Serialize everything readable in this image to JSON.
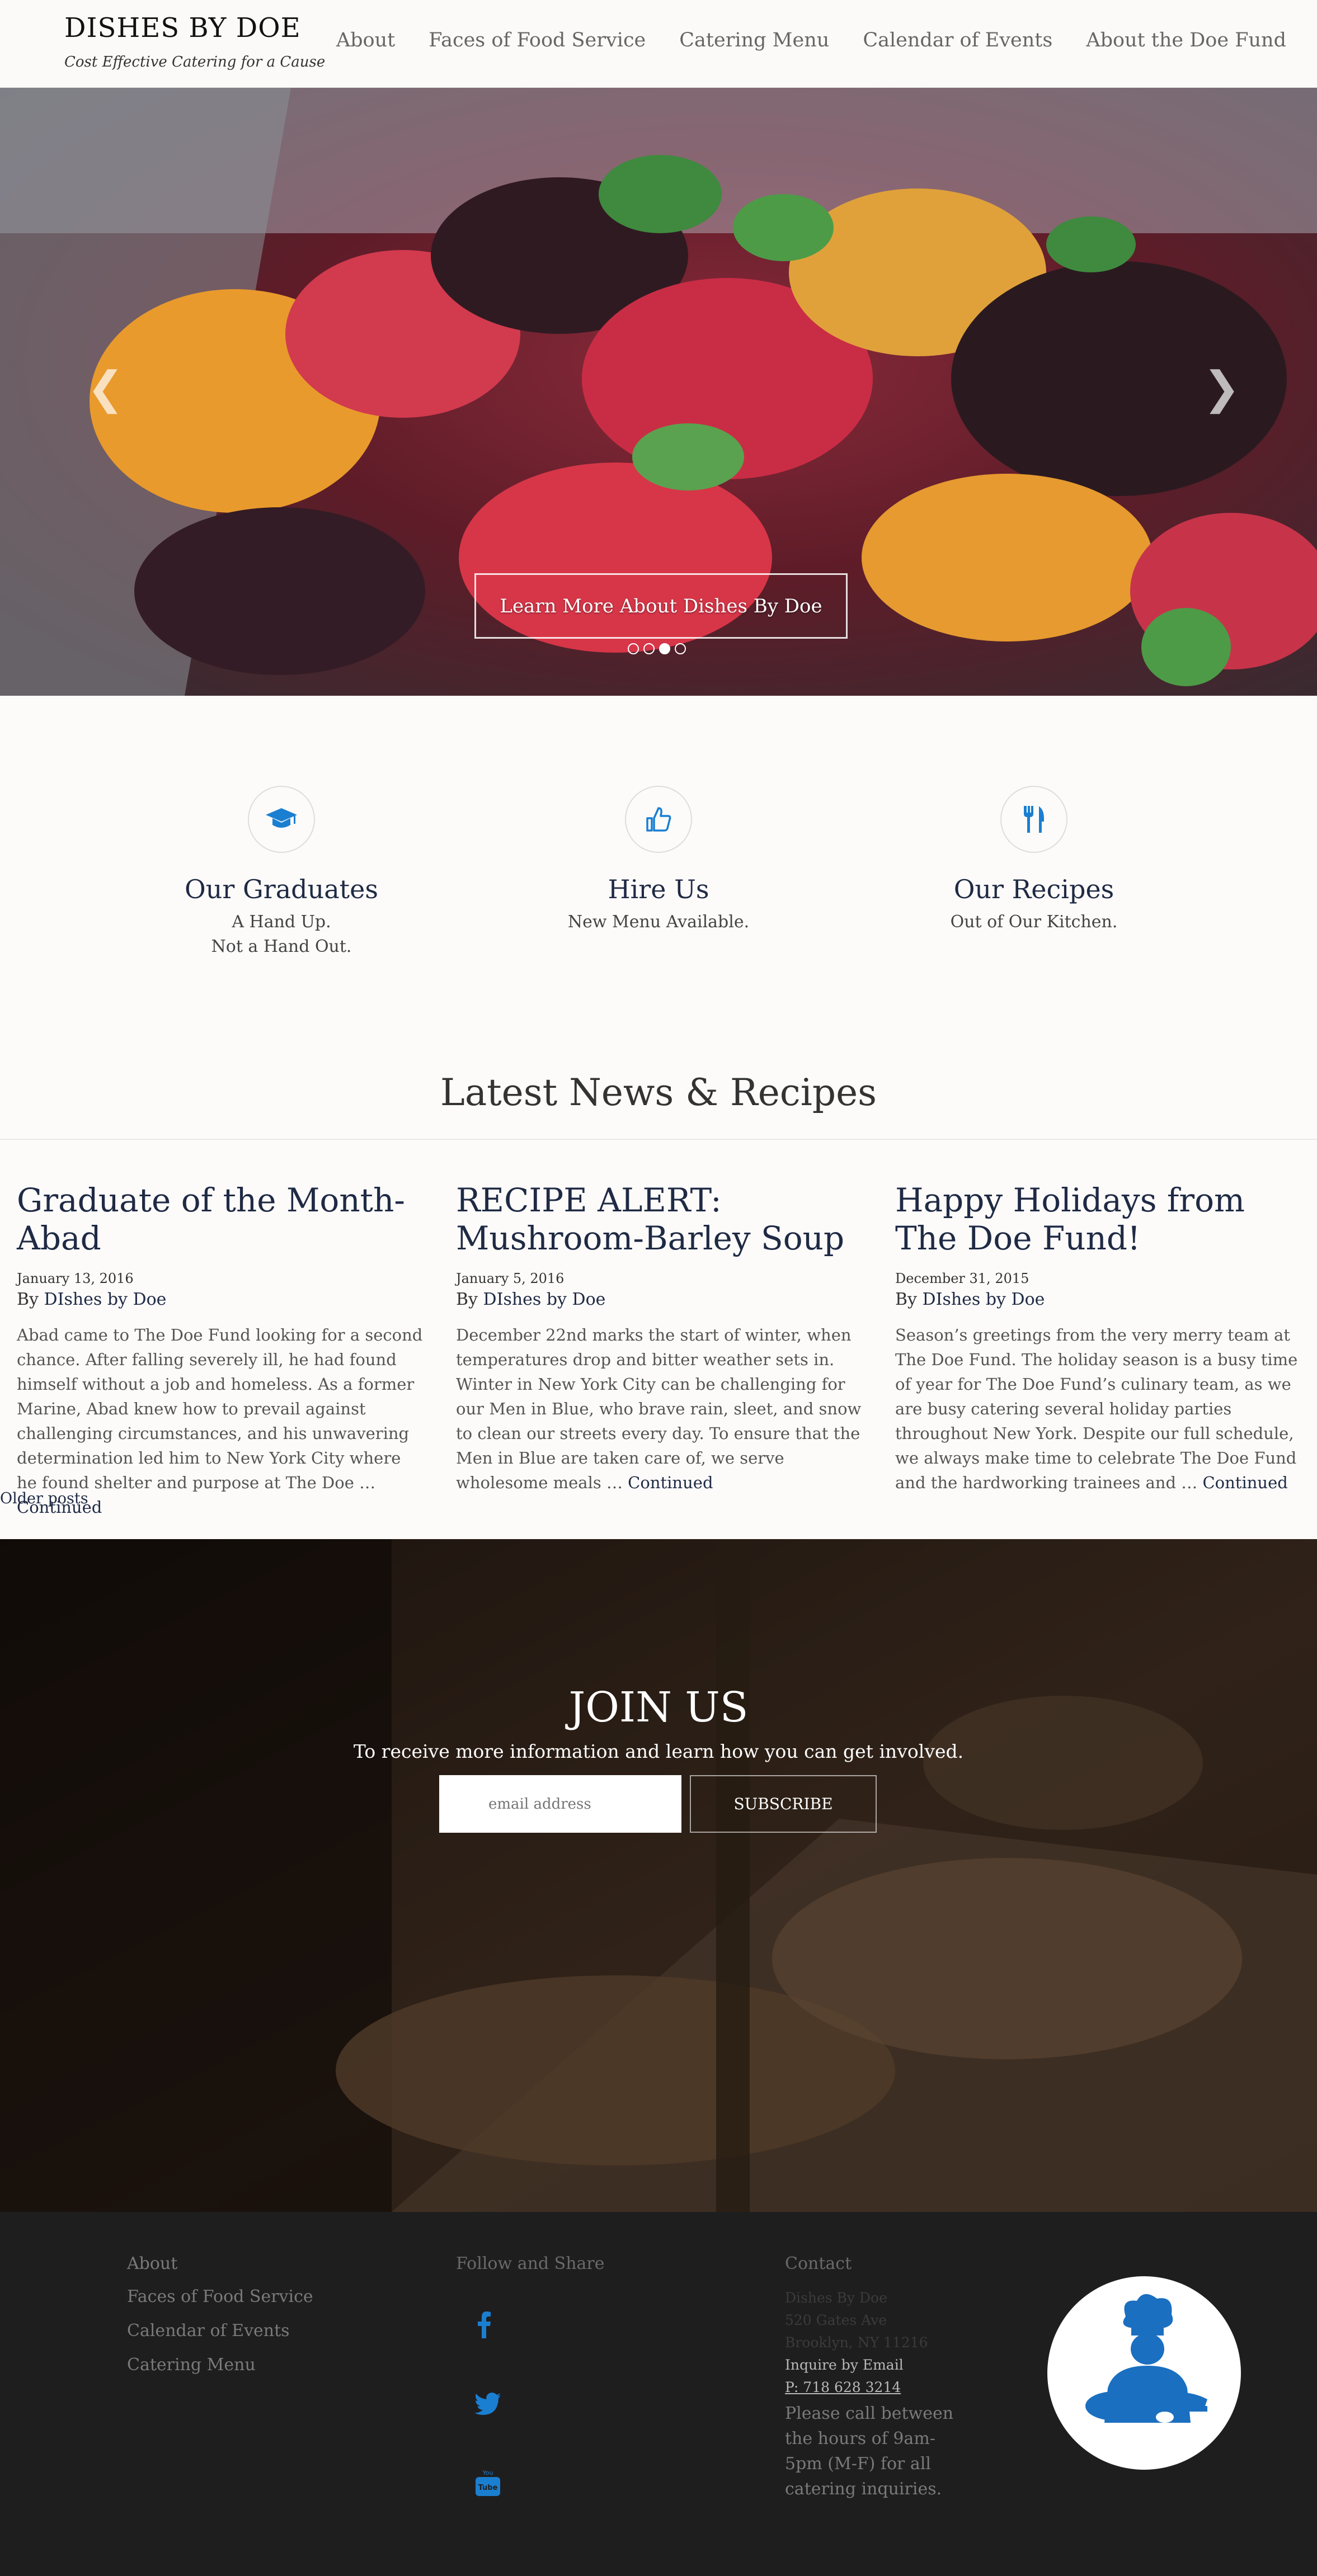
{
  "header": {
    "brand": "DISHES BY DOE",
    "tagline": "Cost Effective Catering for a Cause",
    "nav": [
      "About",
      "Faces of Food Service",
      "Catering Menu",
      "Calendar of Events",
      "About the Doe Fund"
    ]
  },
  "hero": {
    "cta": "Learn More About Dishes By Doe",
    "slides_count": 4,
    "active_slide": 3
  },
  "features": [
    {
      "icon": "graduation-cap-icon",
      "title": "Our Graduates",
      "lines": [
        "A Hand Up.",
        "Not a Hand Out."
      ]
    },
    {
      "icon": "thumbs-up-icon",
      "title": "Hire Us",
      "lines": [
        "New Menu Available."
      ]
    },
    {
      "icon": "fork-knife-icon",
      "title": "Our Recipes",
      "lines": [
        "Out of Our Kitchen."
      ]
    }
  ],
  "news": {
    "heading": "Latest News & Recipes",
    "posts": [
      {
        "title": "Graduate of the Month- Abad",
        "date": "January 13, 2016",
        "author_prefix": "By",
        "author": "DIshes by Doe",
        "excerpt": "Abad came to The Doe Fund looking for a second chance. After falling severely ill, he had found himself without a job and homeless. As a former Marine, Abad knew how to prevail against challenging circumstances, and his unwavering determination led him to New York City where he found shelter and purpose at The Doe …",
        "more": "Continued"
      },
      {
        "title": "RECIPE ALERT: Mushroom-Barley Soup",
        "date": "January 5, 2016",
        "author_prefix": "By",
        "author": "DIshes by Doe",
        "excerpt": "December 22nd marks the start of winter, when temperatures drop and bitter weather sets in. Winter in New York City can be challenging for our Men in Blue, who brave rain, sleet, and snow to clean our streets every day. To ensure that the Men in Blue are taken care of, we serve wholesome meals …",
        "more": "Continued"
      },
      {
        "title": "Happy Holidays from The Doe Fund!",
        "date": "December 31, 2015",
        "author_prefix": "By",
        "author": "DIshes by Doe",
        "excerpt": "Season’s greetings from the very merry team at The Doe Fund. The holiday season is a busy time of year for The Doe Fund’s culinary team, as we are busy catering several holiday parties throughout New York. Despite our full schedule, we always make time to celebrate The Doe Fund and the hardworking trainees and …",
        "more": "Continued"
      }
    ],
    "older": "Older posts"
  },
  "join": {
    "title": "JOIN US",
    "subtitle": "To receive more information and learn how you can get involved.",
    "email_placeholder": "email address",
    "subscribe": "SUBSCRIBE"
  },
  "footer": {
    "links": [
      "About",
      "Faces of Food Service",
      "Calendar of Events",
      "Catering Menu"
    ],
    "follow_heading": "Follow and Share",
    "social": [
      "facebook-icon",
      "twitter-icon",
      "youtube-icon"
    ],
    "contact_heading": "Contact",
    "address": [
      "Dishes By Doe",
      "520 Gates Ave",
      "Brooklyn, NY 11216"
    ],
    "inquire": "Inquire by Email",
    "phone": "P: 718 628 3214",
    "note": "Please call between the hours of 9am-5pm (M-F) for all catering inquiries."
  },
  "colors": {
    "accent": "#1a7fd1",
    "heading": "#1f2a44",
    "footer_bg": "#1f1e1f"
  }
}
